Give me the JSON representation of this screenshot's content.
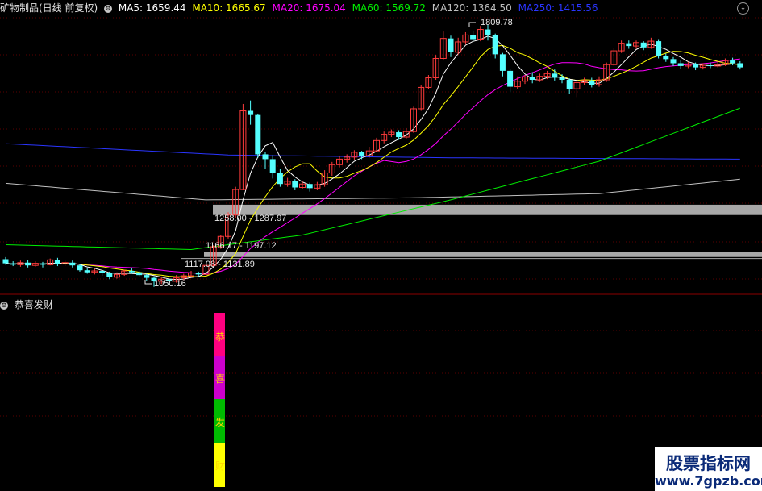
{
  "header": {
    "title": "矿物制品(日线 前复权)",
    "icon": "gear-icon",
    "ma5": "MA5: 1659.44",
    "ma10": "MA10: 1665.67",
    "ma20": "MA20: 1675.04",
    "ma60": "MA60: 1569.72",
    "ma120": "MA120: 1364.50",
    "ma250": "MA250: 1415.56",
    "options_icon": "chevron-down-icon"
  },
  "colors": {
    "up": "#ff3b3b",
    "down": "#54ffff",
    "ma5": "#ffffff",
    "ma10": "#ffff00",
    "ma20": "#ff00ff",
    "ma60": "#00ee00",
    "ma120": "#c0c0c0",
    "ma250": "#2a35ff",
    "grid": "#5a0000",
    "axis": "#8b0000",
    "sig1": "#ff0080",
    "sig2": "#cc00cc",
    "sig3": "#00bb00",
    "sig4": "#ffff00"
  },
  "annotations": {
    "high": "1809.78",
    "low": "1050.16",
    "zone1": "1258.00 - 1287.97",
    "zone2": "1166.17 - 1197.12",
    "zone3": "1117.08 - 1131.89"
  },
  "indicator": {
    "title": "恭喜发财",
    "chars": [
      "恭",
      "喜",
      "发",
      "财"
    ]
  },
  "watermark": {
    "line1": "股票指标网",
    "line2": "www.7gpzb.com"
  },
  "chart_data": {
    "type": "candlestick",
    "title": "矿物制品(日线 前复权)",
    "ylim": [
      1040,
      1830
    ],
    "candles": [
      [
        1130,
        1118,
        1136,
        1114
      ],
      [
        1118,
        1114,
        1124,
        1110
      ],
      [
        1114,
        1120,
        1126,
        1108
      ],
      [
        1120,
        1112,
        1128,
        1106
      ],
      [
        1112,
        1118,
        1124,
        1108
      ],
      [
        1118,
        1114,
        1122,
        1106
      ],
      [
        1114,
        1128,
        1132,
        1112
      ],
      [
        1128,
        1116,
        1134,
        1110
      ],
      [
        1116,
        1120,
        1126,
        1110
      ],
      [
        1120,
        1112,
        1126,
        1106
      ],
      [
        1112,
        1098,
        1116,
        1094
      ],
      [
        1098,
        1092,
        1104,
        1088
      ],
      [
        1092,
        1096,
        1102,
        1086
      ],
      [
        1096,
        1090,
        1100,
        1082
      ],
      [
        1090,
        1078,
        1094,
        1072
      ],
      [
        1078,
        1086,
        1092,
        1074
      ],
      [
        1086,
        1096,
        1100,
        1082
      ],
      [
        1096,
        1092,
        1104,
        1088
      ],
      [
        1092,
        1084,
        1096,
        1080
      ],
      [
        1084,
        1076,
        1088,
        1066
      ],
      [
        1076,
        1066,
        1080,
        1050
      ],
      [
        1066,
        1072,
        1078,
        1058
      ],
      [
        1072,
        1066,
        1076,
        1060
      ],
      [
        1066,
        1076,
        1084,
        1062
      ],
      [
        1076,
        1082,
        1088,
        1070
      ],
      [
        1082,
        1090,
        1096,
        1078
      ],
      [
        1090,
        1086,
        1094,
        1080
      ],
      [
        1086,
        1112,
        1114,
        1084
      ],
      [
        1112,
        1166,
        1170,
        1110
      ],
      [
        1166,
        1196,
        1200,
        1160
      ],
      [
        1196,
        1258,
        1266,
        1190
      ],
      [
        1258,
        1332,
        1340,
        1250
      ],
      [
        1332,
        1560,
        1580,
        1330
      ],
      [
        1560,
        1548,
        1590,
        1520
      ],
      [
        1548,
        1434,
        1552,
        1424
      ],
      [
        1434,
        1420,
        1442,
        1392
      ],
      [
        1420,
        1380,
        1432,
        1364
      ],
      [
        1380,
        1348,
        1392,
        1340
      ],
      [
        1348,
        1356,
        1366,
        1340
      ],
      [
        1356,
        1338,
        1362,
        1330
      ],
      [
        1338,
        1348,
        1356,
        1334
      ],
      [
        1348,
        1336,
        1352,
        1326
      ],
      [
        1336,
        1346,
        1354,
        1330
      ],
      [
        1346,
        1380,
        1388,
        1340
      ],
      [
        1380,
        1404,
        1412,
        1372
      ],
      [
        1404,
        1420,
        1428,
        1396
      ],
      [
        1420,
        1426,
        1434,
        1410
      ],
      [
        1426,
        1440,
        1446,
        1418
      ],
      [
        1440,
        1430,
        1444,
        1420
      ],
      [
        1430,
        1444,
        1456,
        1424
      ],
      [
        1444,
        1474,
        1482,
        1440
      ],
      [
        1474,
        1492,
        1500,
        1466
      ],
      [
        1492,
        1498,
        1506,
        1484
      ],
      [
        1498,
        1484,
        1504,
        1476
      ],
      [
        1484,
        1500,
        1510,
        1478
      ],
      [
        1500,
        1566,
        1572,
        1496
      ],
      [
        1566,
        1628,
        1636,
        1560
      ],
      [
        1628,
        1656,
        1664,
        1622
      ],
      [
        1656,
        1712,
        1722,
        1650
      ],
      [
        1712,
        1770,
        1790,
        1706
      ],
      [
        1770,
        1730,
        1778,
        1716
      ],
      [
        1730,
        1760,
        1772,
        1724
      ],
      [
        1760,
        1780,
        1788,
        1752
      ],
      [
        1780,
        1768,
        1792,
        1760
      ],
      [
        1768,
        1796,
        1806,
        1762
      ],
      [
        1796,
        1780,
        1810,
        1764
      ],
      [
        1780,
        1724,
        1784,
        1712
      ],
      [
        1724,
        1676,
        1728,
        1660
      ],
      [
        1676,
        1630,
        1682,
        1614
      ],
      [
        1630,
        1646,
        1660,
        1622
      ],
      [
        1646,
        1658,
        1664,
        1638
      ],
      [
        1658,
        1650,
        1672,
        1640
      ],
      [
        1650,
        1660,
        1668,
        1644
      ],
      [
        1660,
        1668,
        1676,
        1652
      ],
      [
        1668,
        1656,
        1680,
        1648
      ],
      [
        1656,
        1650,
        1666,
        1640
      ],
      [
        1650,
        1624,
        1654,
        1610
      ],
      [
        1624,
        1642,
        1648,
        1600
      ],
      [
        1642,
        1648,
        1656,
        1634
      ],
      [
        1648,
        1636,
        1656,
        1628
      ],
      [
        1636,
        1650,
        1660,
        1630
      ],
      [
        1650,
        1694,
        1700,
        1644
      ],
      [
        1694,
        1734,
        1742,
        1690
      ],
      [
        1734,
        1756,
        1764,
        1728
      ],
      [
        1756,
        1748,
        1764,
        1740
      ],
      [
        1748,
        1758,
        1764,
        1740
      ],
      [
        1758,
        1744,
        1762,
        1736
      ],
      [
        1744,
        1762,
        1772,
        1740
      ],
      [
        1762,
        1718,
        1768,
        1712
      ],
      [
        1718,
        1710,
        1726,
        1702
      ],
      [
        1710,
        1698,
        1716,
        1690
      ],
      [
        1698,
        1690,
        1706,
        1682
      ],
      [
        1690,
        1696,
        1702,
        1684
      ],
      [
        1696,
        1686,
        1700,
        1678
      ],
      [
        1686,
        1692,
        1698,
        1680
      ],
      [
        1692,
        1690,
        1700,
        1684
      ],
      [
        1690,
        1694,
        1704,
        1686
      ],
      [
        1694,
        1706,
        1712,
        1690
      ],
      [
        1706,
        1698,
        1714,
        1692
      ],
      [
        1698,
        1686,
        1704,
        1680
      ]
    ],
    "ma_series": [
      {
        "name": "MA5",
        "value": 1659.44
      },
      {
        "name": "MA10",
        "value": 1665.67
      },
      {
        "name": "MA20",
        "value": 1675.04
      },
      {
        "name": "MA60",
        "value": 1569.72
      },
      {
        "name": "MA120",
        "value": 1364.5
      },
      {
        "name": "MA250",
        "value": 1415.56
      }
    ],
    "zones": [
      {
        "low": 1258.0,
        "high": 1287.97
      },
      {
        "low": 1166.17,
        "high": 1197.12
      },
      {
        "low": 1117.08,
        "high": 1131.89
      }
    ],
    "high_label": 1809.78,
    "low_label": 1050.16
  }
}
